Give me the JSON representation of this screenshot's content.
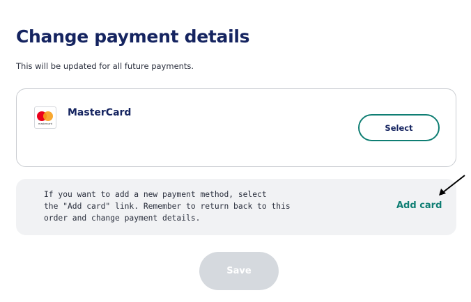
{
  "header": {
    "title": "Change payment details",
    "subtitle": "This will be updated for all future payments."
  },
  "card": {
    "logo_icon": "mastercard-logo-icon",
    "logo_text": "mastercard",
    "name": "MasterCard",
    "select_label": "Select"
  },
  "info": {
    "lines": [
      "If you want to add a new payment method, select",
      "the \"Add card\" link. Remember to return back to this",
      "order and change payment details."
    ],
    "add_card_label": "Add card",
    "arrow_icon": "arrow-annotation-icon"
  },
  "footer": {
    "save_label": "Save"
  },
  "colors": {
    "heading": "#152460",
    "accent": "#0f7e73",
    "disabled_button": "#d5d9de",
    "info_bg": "#f1f2f4"
  }
}
